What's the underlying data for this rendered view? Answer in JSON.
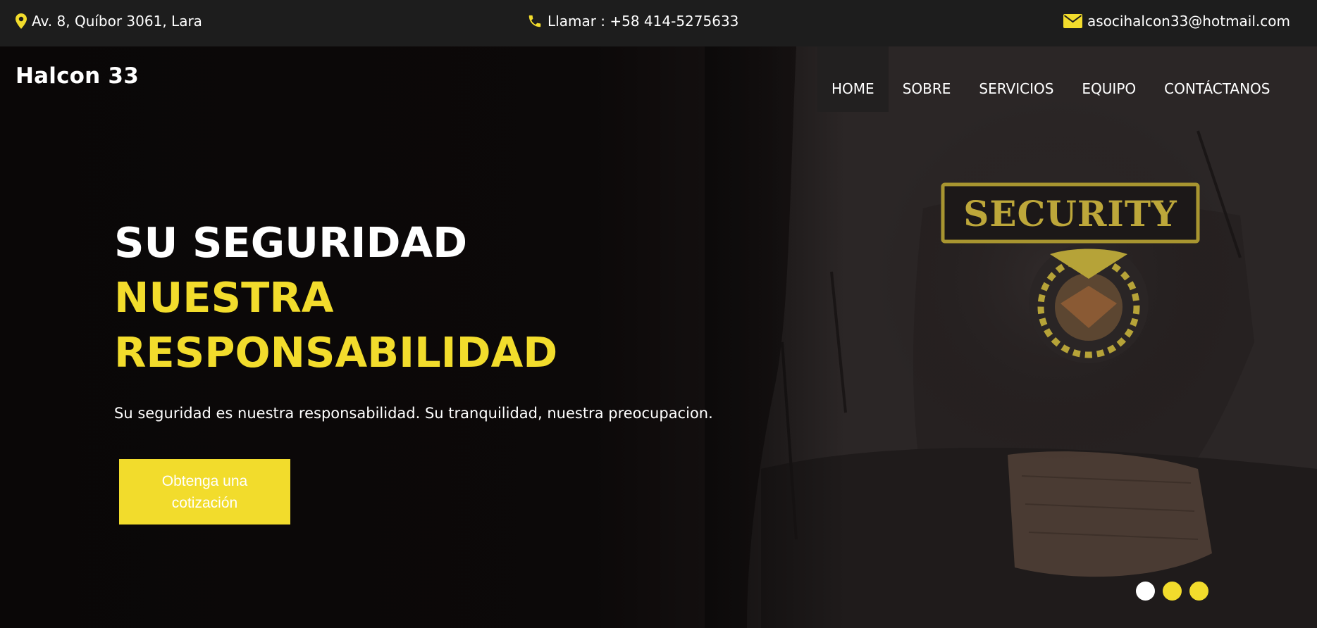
{
  "topbar": {
    "address": "Av. 8, Quíbor 3061, Lara",
    "address_icon": "map-marker-icon",
    "phone": "Llamar : +58 414-5275633",
    "phone_icon": "phone-icon",
    "email": "asocihalcon33@hotmail.com",
    "email_icon": "envelope-icon"
  },
  "brand": "Halcon 33",
  "nav": {
    "items": [
      {
        "label": "HOME",
        "active": true
      },
      {
        "label": "SOBRE"
      },
      {
        "label": "SERVICIOS"
      },
      {
        "label": "EQUIPO"
      },
      {
        "label": "CONTÁCTANOS"
      }
    ]
  },
  "hero": {
    "headline_line1": "SU SEGURIDAD",
    "headline_line2": "NUESTRA",
    "headline_line3": "RESPONSABILIDAD",
    "subtitle": "Su seguridad es nuestra responsabilidad. Su tranquilidad, nuestra preocupacion.",
    "cta_label": "Obtenga una cotización",
    "patch_text": "SECURITY",
    "slides": 3,
    "active_slide": 1
  },
  "colors": {
    "accent": "#f2dc2c",
    "topbar_bg": "#1d1d1d",
    "hero_bg": "#0b0909"
  }
}
